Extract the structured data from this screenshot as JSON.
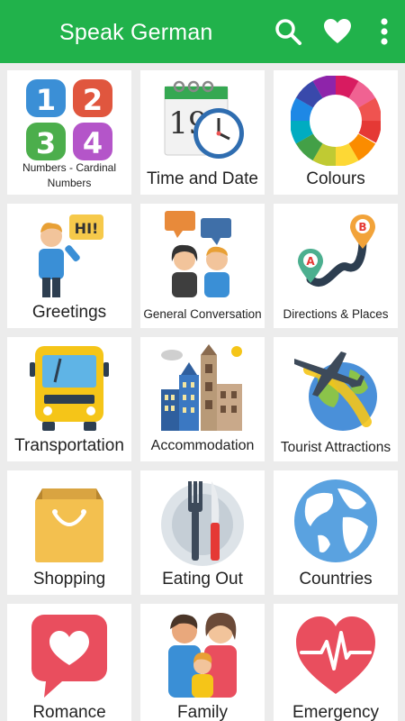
{
  "appbar": {
    "title": "Speak German",
    "color": "#21b24b",
    "icons": [
      "search-icon",
      "heart-icon",
      "more-vertical-icon"
    ]
  },
  "categories": [
    {
      "label": "Numbers - Cardinal Numbers",
      "icon": "numbers-icon"
    },
    {
      "label": "Time and Date",
      "icon": "calendar-clock-icon"
    },
    {
      "label": "Colours",
      "icon": "color-wheel-icon"
    },
    {
      "label": "Greetings",
      "icon": "greeting-person-icon"
    },
    {
      "label": "General Conversation",
      "icon": "conversation-icon"
    },
    {
      "label": "Directions & Places",
      "icon": "route-pins-icon"
    },
    {
      "label": "Transportation",
      "icon": "bus-icon"
    },
    {
      "label": "Accommodation",
      "icon": "city-buildings-icon"
    },
    {
      "label": "Tourist Attractions",
      "icon": "airplane-globe-icon"
    },
    {
      "label": "Shopping",
      "icon": "shopping-bag-icon"
    },
    {
      "label": "Eating Out",
      "icon": "plate-cutlery-icon"
    },
    {
      "label": "Countries",
      "icon": "globe-icon"
    },
    {
      "label": "Romance",
      "icon": "heart-bubble-icon"
    },
    {
      "label": "Family",
      "icon": "family-icon"
    },
    {
      "label": "Emergency",
      "icon": "heartbeat-icon"
    }
  ],
  "numbers_tile_digits": [
    "1",
    "2",
    "3",
    "4"
  ],
  "time_tile_digits": "19"
}
